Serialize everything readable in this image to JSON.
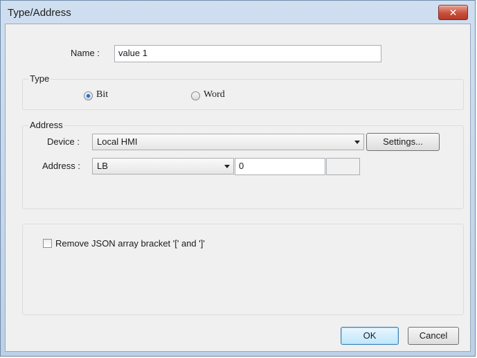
{
  "window": {
    "title": "Type/Address",
    "close_glyph": "✕"
  },
  "name_field": {
    "label": "Name :",
    "value": "value 1"
  },
  "type_group": {
    "title": "Type",
    "options": [
      {
        "label": "Bit",
        "selected": true
      },
      {
        "label": "Word",
        "selected": false
      }
    ]
  },
  "address_group": {
    "title": "Address",
    "device": {
      "label": "Device :",
      "value": "Local HMI"
    },
    "settings_button": "Settings...",
    "address": {
      "label": "Address :",
      "type": "LB",
      "value": "0",
      "extra": ""
    }
  },
  "options_group": {
    "remove_bracket": {
      "label": "Remove JSON array bracket '[' and ']'",
      "checked": false
    }
  },
  "footer": {
    "ok_label": "OK",
    "cancel_label": "Cancel"
  },
  "colors": {
    "accent": "#3c7fb1",
    "close": "#c7503c",
    "title_bg": "#bcd0e6"
  },
  "icons": {
    "close": "close-icon",
    "dropdown": "chevron-down-icon"
  }
}
